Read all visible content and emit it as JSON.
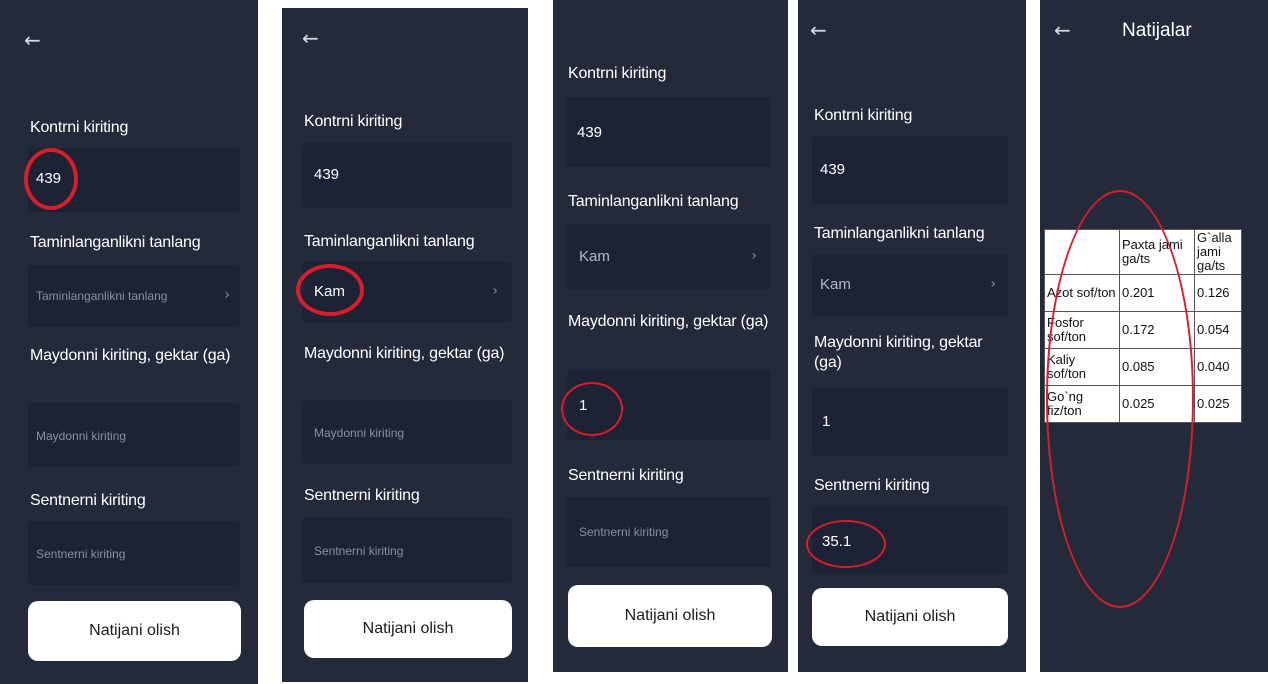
{
  "screens": [
    {
      "back_icon": "←",
      "kontur_label": "Kontrni kiriting",
      "kontur_value": "439",
      "taminlanganlik_label": "Taminlanganlikni tanlang",
      "taminlanganlik_placeholder": "Taminlanganlikni tanlang",
      "maydon_label": "Maydonni kiriting, gektar (ga)",
      "maydon_placeholder": "Maydonni kiriting",
      "sentner_label": "Sentnerni kiriting",
      "sentner_placeholder": "Sentnerni kiriting",
      "button_label": "Natijani olish"
    },
    {
      "back_icon": "←",
      "kontur_label": "Kontrni kiriting",
      "kontur_value": "439",
      "taminlanganlik_label": "Taminlanganlikni tanlang",
      "taminlanganlik_value": "Kam",
      "maydon_label": "Maydonni kiriting, gektar (ga)",
      "maydon_placeholder": "Maydonni kiriting",
      "sentner_label": "Sentnerni kiriting",
      "sentner_placeholder": "Sentnerni kiriting",
      "button_label": "Natijani olish"
    },
    {
      "kontur_label": "Kontrni kiriting",
      "kontur_value": "439",
      "taminlanganlik_label": "Taminlanganlikni tanlang",
      "taminlanganlik_value": "Kam",
      "maydon_label": "Maydonni kiriting, gektar (ga)",
      "maydon_value": "1",
      "sentner_label": "Sentnerni kiriting",
      "sentner_placeholder": "Sentnerni kiriting",
      "button_label": "Natijani olish"
    },
    {
      "back_icon": "←",
      "kontur_label": "Kontrni kiriting",
      "kontur_value": "439",
      "taminlanganlik_label": "Taminlanganlikni tanlang",
      "taminlanganlik_value": "Kam",
      "maydon_label": "Maydonni kiriting, gektar (ga)",
      "maydon_value": "1",
      "sentner_label": "Sentnerni kiriting",
      "sentner_value": "35.1",
      "button_label": "Natijani olish"
    },
    {
      "back_icon": "←",
      "title": "Natijalar",
      "table": {
        "headers": [
          "",
          "Paxta jami ga/ts",
          "G`alla jami ga/ts"
        ],
        "rows": [
          [
            "Azot sof/ton",
            "0.201",
            "0.126"
          ],
          [
            "Fosfor sof/ton",
            "0.172",
            "0.054"
          ],
          [
            "Kaliy sof/ton",
            "0.085",
            "0.040"
          ],
          [
            "Go`ng fiz/ton",
            "0.025",
            "0.025"
          ]
        ]
      }
    }
  ],
  "chevron_icon": "›",
  "colors": {
    "screen_bg": "#252a3b",
    "field_bg": "#1d2234",
    "highlight_circle": "#d81e2a",
    "button_bg": "#ffffff"
  }
}
